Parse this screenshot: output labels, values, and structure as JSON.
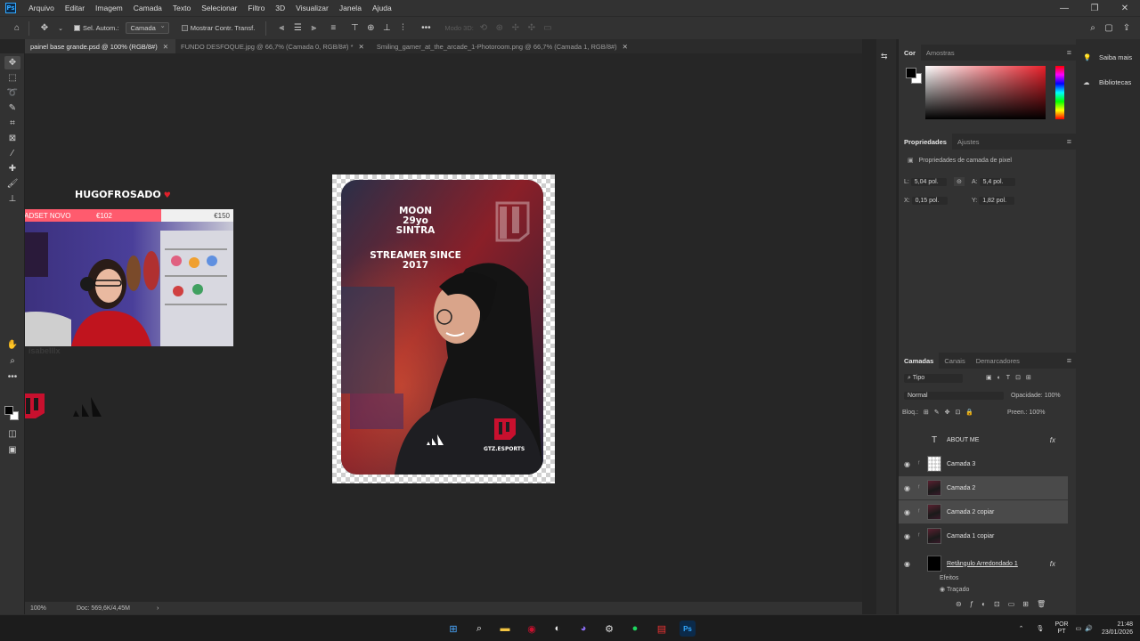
{
  "app": {
    "logo": "Ps"
  },
  "menu": [
    "Arquivo",
    "Editar",
    "Imagem",
    "Camada",
    "Texto",
    "Selecionar",
    "Filtro",
    "3D",
    "Visualizar",
    "Janela",
    "Ajuda"
  ],
  "options": {
    "auto_select_label": "Sel. Autom.:",
    "auto_select_value": "Camada",
    "show_transform_label": "Mostrar Contr. Transf.",
    "mode3d_label": "Modo 3D:"
  },
  "tabs": [
    {
      "label": "painel base grande.psd @ 100% (RGB/8#)"
    },
    {
      "label": "FUNDO DESFOQUE.jpg @ 66,7% (Camada 0, RGB/8#) *"
    },
    {
      "label": "Smiling_gamer_at_the_arcade_1-Photoroom.png @ 66,7% (Camada 1, RGB/8#)"
    }
  ],
  "canvas": {
    "streamer_name": "HUGOFROSADO",
    "heart": "♥",
    "goal_label": "HEADSET NOVO",
    "goal_current": "€102",
    "goal_target": "€150",
    "goal_progress": 0.68,
    "watermark": "isabelllx",
    "card_name_lines": "MOON\n29yo\nSINTRA",
    "card_streamer_lines": "STREAMER SINCE\n2017",
    "card_brand": "GTZ.ESPORTS"
  },
  "status": {
    "zoom": "100%",
    "doc": "Doc: 569,6K/4,45M"
  },
  "right_strip": {
    "learn": "Saiba mais",
    "libraries": "Bibliotecas"
  },
  "color_panel": {
    "tab_color": "Cor",
    "tab_swatches": "Amostras",
    "fg": "#000000",
    "bg": "#ffffff"
  },
  "properties": {
    "tab_props": "Propriedades",
    "tab_adjust": "Ajustes",
    "kind": "Propriedades de camada de pixel",
    "w_label": "L:",
    "w": "5,04 pol.",
    "h_label": "A:",
    "h": "5,4 pol.",
    "x_label": "X:",
    "x": "0,15 pol.",
    "y_label": "Y:",
    "y": "1,82 pol."
  },
  "layers_panel": {
    "tab_layers": "Camadas",
    "tab_channels": "Canais",
    "tab_paths": "Demarcadores",
    "filter": "Tipo",
    "blend": "Normal",
    "opacity_label": "Opacidade:",
    "opacity": "100%",
    "lock_label": "Bloq.:",
    "fill_label": "Preen.:",
    "fill": "100%",
    "layers": [
      {
        "name": "ABOUT ME",
        "kind": "text",
        "visible": false,
        "fx": true,
        "selected": false
      },
      {
        "name": "Camada 3",
        "kind": "transparent",
        "visible": true,
        "fx": false,
        "selected": false
      },
      {
        "name": "Camada 2",
        "kind": "photo",
        "visible": true,
        "fx": false,
        "selected": true
      },
      {
        "name": "Camada 2 copiar",
        "kind": "photo",
        "visible": true,
        "fx": false,
        "selected": true
      },
      {
        "name": "Camada 1 copiar",
        "kind": "photo",
        "visible": true,
        "fx": false,
        "selected": false
      },
      {
        "name": "Retângulo Arredondado 1",
        "kind": "black",
        "visible": true,
        "fx": true,
        "selected": false
      }
    ],
    "effects_label": "Efeitos",
    "stroke_label": "Traçado"
  },
  "taskbar": {
    "lang": "POR",
    "lang2": "PT",
    "time": "21:48",
    "date": "23/01/2026"
  }
}
